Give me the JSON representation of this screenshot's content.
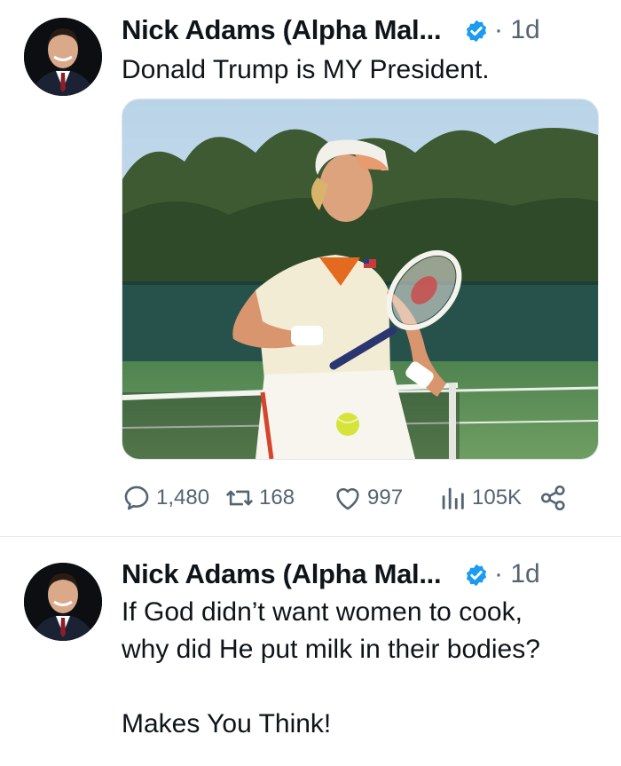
{
  "tweets": [
    {
      "author": "Nick Adams (Alpha Mal...",
      "verified": true,
      "time": "· 1d",
      "text": "Donald Trump is MY President.",
      "media": {
        "description_icon": "image-icon"
      },
      "stats": {
        "replies": "1,480",
        "retweets": "168",
        "likes": "997",
        "views": "105K"
      }
    },
    {
      "author": "Nick Adams (Alpha Mal...",
      "verified": true,
      "time": "· 1d",
      "text": "If God didn’t want women to cook,\nwhy did He put milk in their bodies?\n\nMakes You Think!"
    }
  ],
  "colors": {
    "verified": "#1d9bf0",
    "muted": "#536471",
    "text": "#0f1419"
  }
}
